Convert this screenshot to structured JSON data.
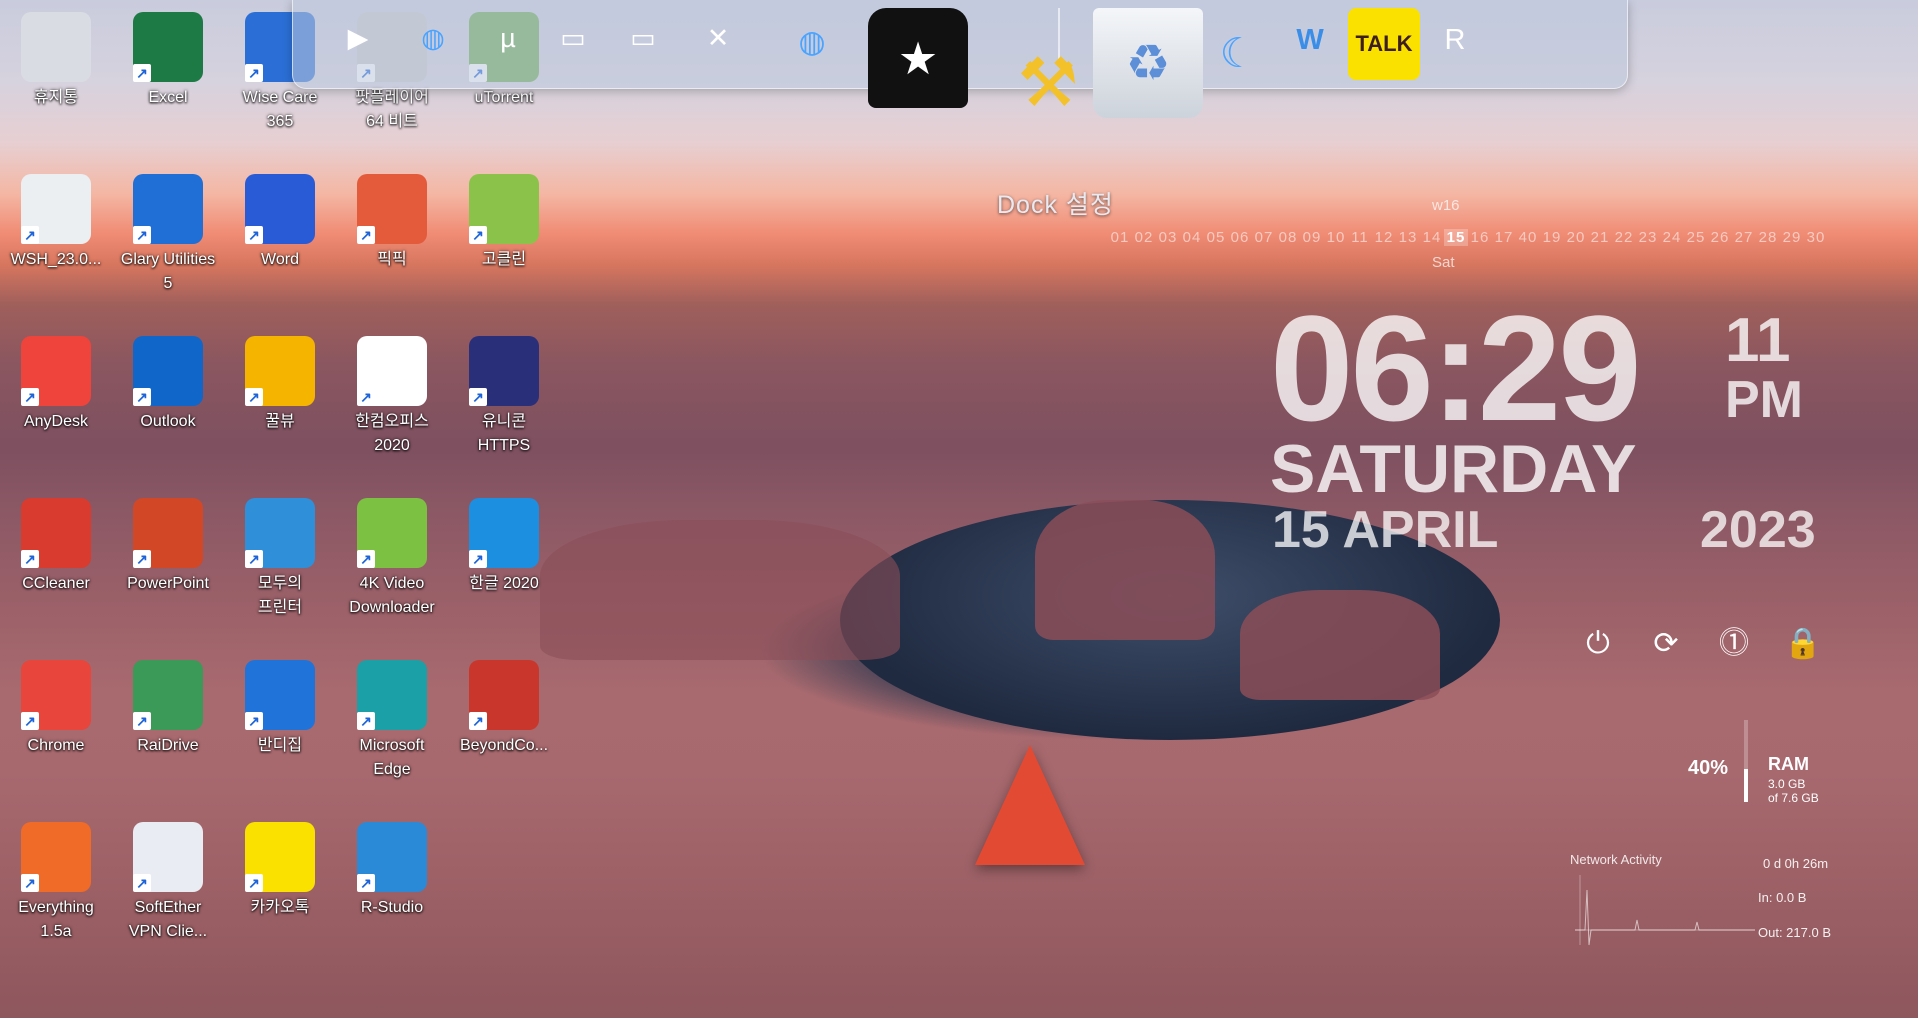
{
  "desktop_icons": [
    {
      "label": "휴지통",
      "icon": "recycle-bin-icon",
      "color": "#d9dde3"
    },
    {
      "label": "Excel",
      "icon": "excel-icon",
      "color": "#1d7a45"
    },
    {
      "label": "Wise Care\n365",
      "icon": "wise-care-icon",
      "color": "#2b6fd6"
    },
    {
      "label": "팟플레이어\n64 비트",
      "icon": "potplayer-icon",
      "color": "#c9c9c9"
    },
    {
      "label": "uTorrent",
      "icon": "utorrent-icon",
      "color": "#6aa84f"
    },
    {
      "label": "WSH_23.0...",
      "icon": "wsh-file-icon",
      "color": "#eceff2"
    },
    {
      "label": "Glary Utilities\n5",
      "icon": "glary-icon",
      "color": "#1f6fd6"
    },
    {
      "label": "Word",
      "icon": "word-icon",
      "color": "#2a5bd7"
    },
    {
      "label": "픽픽",
      "icon": "picpick-icon",
      "color": "#e45b3c"
    },
    {
      "label": "고클린",
      "icon": "goclean-icon",
      "color": "#8bc34a"
    },
    {
      "label": "AnyDesk",
      "icon": "anydesk-icon",
      "color": "#ef443b"
    },
    {
      "label": "Outlook",
      "icon": "outlook-icon",
      "color": "#1066c9"
    },
    {
      "label": "꿀뷰",
      "icon": "honeyview-icon",
      "color": "#f5b400"
    },
    {
      "label": "한컴오피스\n2020",
      "icon": "hancom-office-icon",
      "color": "#ffffff"
    },
    {
      "label": "유니콘\nHTTPS",
      "icon": "unicorn-https-icon",
      "color": "#2a2f7a"
    },
    {
      "label": "CCleaner",
      "icon": "ccleaner-icon",
      "color": "#d93b2e"
    },
    {
      "label": "PowerPoint",
      "icon": "powerpoint-icon",
      "color": "#d24726"
    },
    {
      "label": "모두의\n프린터",
      "icon": "printer-icon",
      "color": "#2f8fd8"
    },
    {
      "label": "4K Video\nDownloader",
      "icon": "video-downloader-icon",
      "color": "#7cc142"
    },
    {
      "label": "한글 2020",
      "icon": "hangul-icon",
      "color": "#1d8fe0"
    },
    {
      "label": "Chrome",
      "icon": "chrome-icon",
      "color": "#e8453c"
    },
    {
      "label": "RaiDrive",
      "icon": "raidrive-icon",
      "color": "#3b9a58"
    },
    {
      "label": "반디집",
      "icon": "bandizip-icon",
      "color": "#1f73d9"
    },
    {
      "label": "Microsoft\nEdge",
      "icon": "edge-icon",
      "color": "#1aa0a6"
    },
    {
      "label": "BeyondCo...",
      "icon": "beyond-compare-icon",
      "color": "#c9362b"
    },
    {
      "label": "Everything\n1.5a",
      "icon": "everything-search-icon",
      "color": "#f06a28"
    },
    {
      "label": "SoftEther\nVPN Clie...",
      "icon": "softether-icon",
      "color": "#e9ecf2"
    },
    {
      "label": "카카오톡",
      "icon": "kakaotalk-icon",
      "color": "#fae100"
    },
    {
      "label": "R-Studio",
      "icon": "rstudio-icon",
      "color": "#2b8ad8"
    }
  ],
  "dock": {
    "items": [
      {
        "name": "potplayer-icon",
        "glyph": "▶"
      },
      {
        "name": "globe-network-icon",
        "glyph": "◍"
      },
      {
        "name": "utorrent-icon",
        "glyph": "µ"
      },
      {
        "name": "folder-icon",
        "glyph": "▭"
      },
      {
        "name": "folder-open-icon",
        "glyph": "▭"
      },
      {
        "name": "tools-icon",
        "glyph": "✕"
      },
      {
        "name": "globe-icon",
        "glyph": "◍"
      },
      {
        "name": "tshirt-icon",
        "glyph": "★"
      },
      {
        "name": "hammer-settings-icon",
        "glyph": "⚒"
      },
      {
        "name": "recycle-bin-icon",
        "glyph": "♻"
      },
      {
        "name": "glary-icon",
        "glyph": "☾"
      },
      {
        "name": "wise-care-icon",
        "glyph": "W"
      },
      {
        "name": "kakaotalk-icon",
        "glyph": "TALK"
      },
      {
        "name": "rstudio-icon",
        "glyph": "R"
      }
    ],
    "tooltip": "Dock 설정"
  },
  "calendar": {
    "week": "w16",
    "days": [
      "01",
      "02",
      "03",
      "04",
      "05",
      "06",
      "07",
      "08",
      "09",
      "10",
      "11",
      "12",
      "13",
      "14",
      "15",
      "16",
      "17",
      "40",
      "19",
      "20",
      "21",
      "22",
      "23",
      "24",
      "25",
      "26",
      "27",
      "28",
      "29",
      "30"
    ],
    "today": "15",
    "weekday": "Sat"
  },
  "clock": {
    "time": "06:29",
    "seconds": "11",
    "ampm": "PM",
    "day": "SATURDAY",
    "date": "15 APRIL",
    "year": "2023"
  },
  "power_buttons": [
    {
      "name": "shutdown-icon",
      "glyph": "⏻"
    },
    {
      "name": "restart-icon",
      "glyph": "⟳"
    },
    {
      "name": "logoff-icon",
      "glyph": "⓵"
    },
    {
      "name": "lock-icon",
      "glyph": "🔒"
    }
  ],
  "system": {
    "ram_percent_label": "40%",
    "ram_fraction": 0.4,
    "ram_label": "RAM",
    "ram_used": "3.0 GB",
    "ram_total": "of 7.6 GB",
    "network_title": "Network Activity",
    "uptime": "0 d 0h 26m",
    "net_in": "In: 0.0 B",
    "net_out": "Out: 217.0 B"
  }
}
